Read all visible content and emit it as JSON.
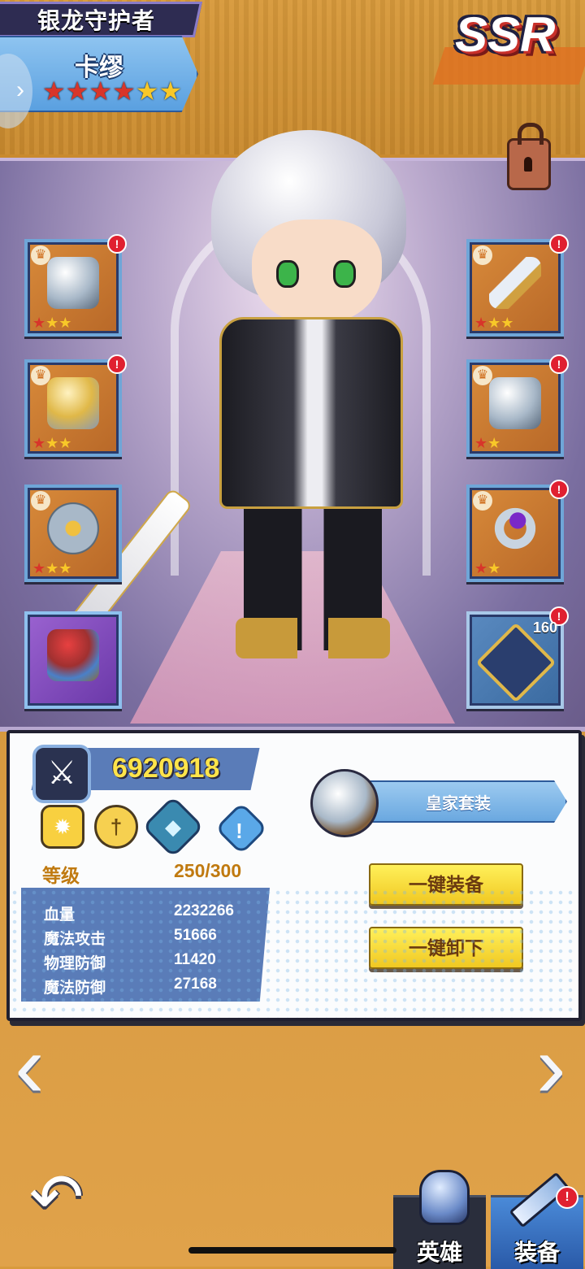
{
  "header": {
    "title": "银龙守护者",
    "hero_name": "卡缪",
    "stars_red": 4,
    "stars_gold": 2,
    "rarity": "SSR"
  },
  "icons": {
    "lock": "lock-icon",
    "nav_left": "chevron-right-icon"
  },
  "equipment": {
    "left": [
      {
        "name": "helmet",
        "stars": 3,
        "red_stars": 1
      },
      {
        "name": "armor",
        "stars": 3,
        "red_stars": 1
      },
      {
        "name": "shield",
        "stars": 3,
        "red_stars": 1
      },
      {
        "name": "hammer",
        "stars": 0,
        "red_stars": 0
      }
    ],
    "right": [
      {
        "name": "sword",
        "stars": 3,
        "red_stars": 1
      },
      {
        "name": "boots",
        "stars": 2,
        "red_stars": 1
      },
      {
        "name": "ring",
        "stars": 2,
        "red_stars": 1
      },
      {
        "name": "emblem",
        "count": "160"
      }
    ]
  },
  "panel": {
    "power": "6920918",
    "level_label": "等级",
    "level_value": "250/300",
    "stats": [
      {
        "label": "血量",
        "value": "2232266"
      },
      {
        "label": "魔法攻击",
        "value": "51666"
      },
      {
        "label": "物理防御",
        "value": "11420"
      },
      {
        "label": "魔法防御",
        "value": "27168"
      }
    ],
    "set_name": "皇家套装",
    "equip_all": "一键装备",
    "unequip_all": "一键卸下",
    "skill_alert": "!"
  },
  "tabs": {
    "hero": "英雄",
    "equip": "装备"
  },
  "colors": {
    "accent_gold": "#ffe44a",
    "panel_blue": "#5a7cb8",
    "alert_red": "#e02030"
  }
}
